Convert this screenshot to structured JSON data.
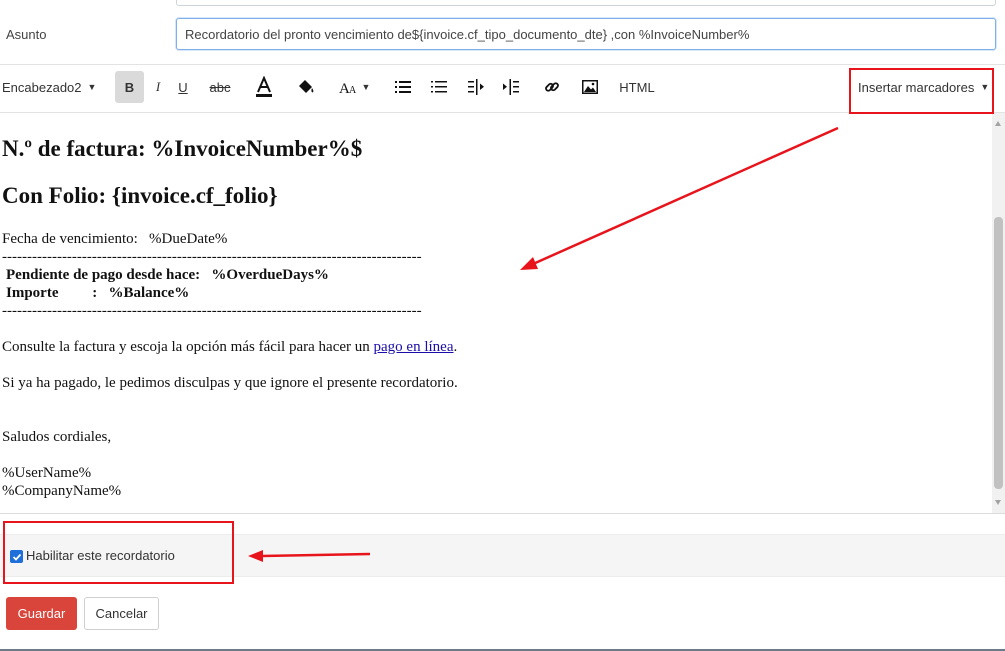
{
  "subject": {
    "label": "Asunto",
    "value": "Recordatorio del pronto vencimiento de${invoice.cf_tipo_documento_dte} ,con %InvoiceNumber%"
  },
  "toolbar": {
    "heading": "Encabezado2",
    "bold": "B",
    "italic": "I",
    "underline": "U",
    "strikethrough": "abc",
    "html": "HTML",
    "insert_markers": "Insertar marcadores"
  },
  "editor": {
    "heading_invoice": "N.º de factura: %InvoiceNumber%$",
    "heading_folio": "Con Folio: {invoice.cf_folio}",
    "due_date": "Fecha de vencimiento:   %DueDate%",
    "separator": "------------------------------------------------------------------------------------",
    "overdue": "Pendiente de pago desde hace:   %OverdueDays%",
    "amount": "Importe         :   %Balance%",
    "consult_text": "Consulte la factura y escoja la opción más fácil para hacer un ",
    "consult_link": "pago en línea",
    "consult_end": ".",
    "already_paid": "Si ya ha pagado, le pedimos disculpas y que ignore el presente recordatorio.",
    "regards": "Saludos cordiales,",
    "user_name": "%UserName%",
    "company_name": "%CompanyName%"
  },
  "enable_reminder": {
    "label": "Habilitar este recordatorio",
    "checked": true
  },
  "buttons": {
    "save": "Guardar",
    "cancel": "Cancelar"
  },
  "colors": {
    "primary_button": "#d9453a",
    "checkbox": "#1e6fd9",
    "annotation": "#e8141c",
    "link": "#1a0dab"
  }
}
